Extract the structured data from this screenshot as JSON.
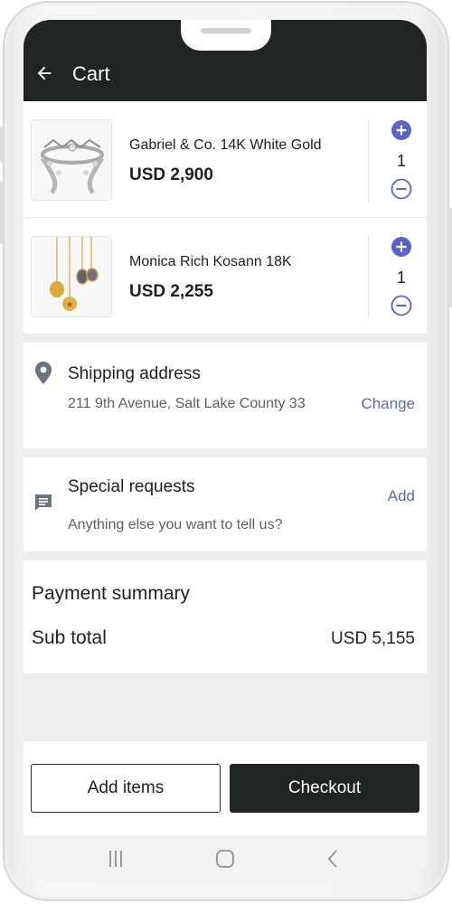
{
  "header": {
    "title": "Cart",
    "back_icon": "arrow-left-icon"
  },
  "cart": {
    "items": [
      {
        "name": "Gabriel & Co. 14K White Gold",
        "price": "USD 2,900",
        "quantity": "1",
        "image": "diamond-ring-image"
      },
      {
        "name": "Monica Rich Kosann 18K",
        "price": "USD 2,255",
        "quantity": "1",
        "image": "gold-pendants-image"
      }
    ]
  },
  "shipping": {
    "title": "Shipping address",
    "address": "211 9th Avenue, Salt Lake County 33",
    "action": "Change",
    "icon": "location-pin-icon"
  },
  "special_requests": {
    "title": "Special requests",
    "subtitle": "Anything else you want to tell us?",
    "action": "Add",
    "icon": "chat-bubble-icon"
  },
  "payment_summary": {
    "title": "Payment summary",
    "subtotal_label": "Sub total",
    "subtotal_value": "USD 5,155"
  },
  "actions": {
    "add_items": "Add items",
    "checkout": "Checkout"
  },
  "colors": {
    "header_bg": "#212424",
    "accent": "#5b6f9e",
    "qty_icon": "#5a64c8"
  },
  "system_nav": [
    "recents-icon",
    "home-icon",
    "back-icon"
  ]
}
